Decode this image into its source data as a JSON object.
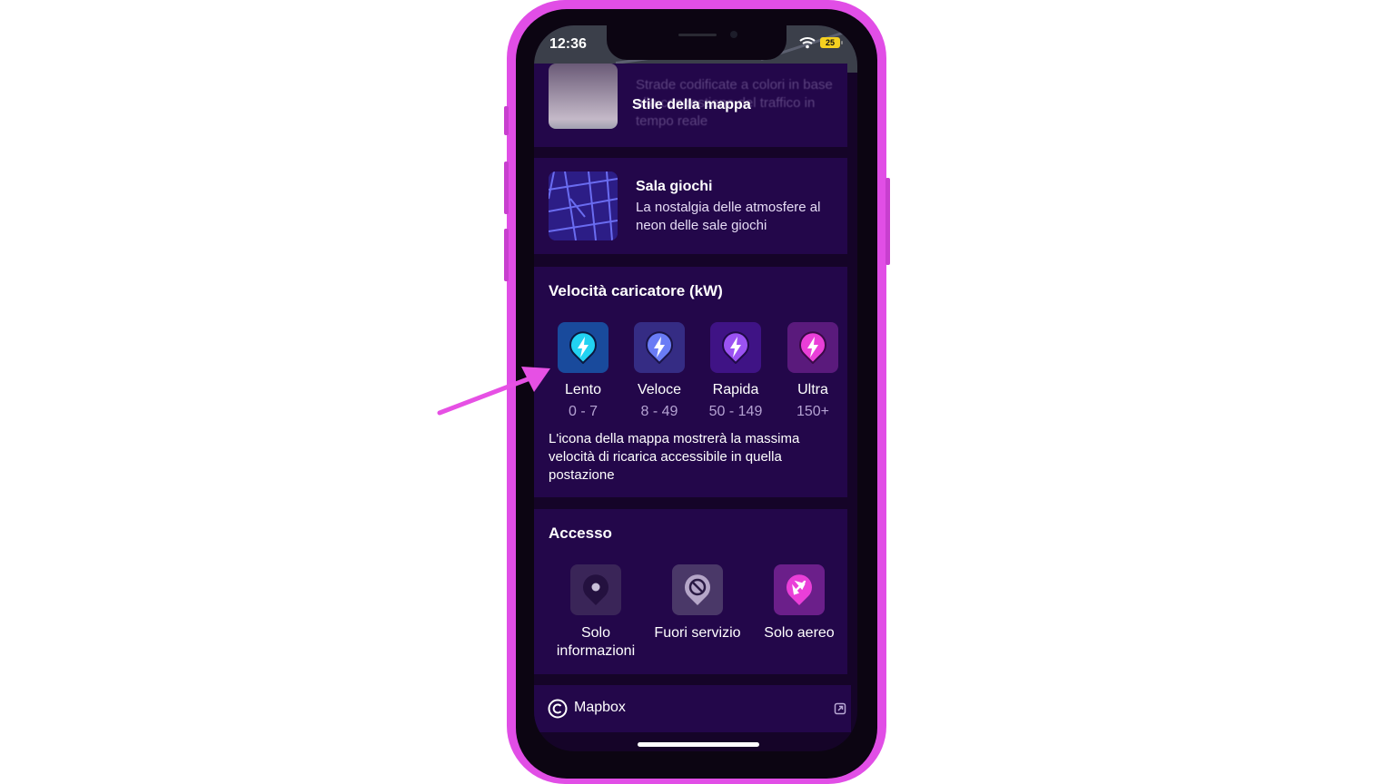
{
  "status_bar": {
    "time": "12:36",
    "battery": "25"
  },
  "map_style_card": {
    "selected_name": "Stile della mappa",
    "faded_description": "Strade codificate a colori in base alla congestione del traffico in tempo reale"
  },
  "arcade_style": {
    "name": "Sala giochi",
    "description": "La nostalgia delle atmosfere al neon delle sale giochi"
  },
  "charger_speed": {
    "title": "Velocità caricatore (kW)",
    "items": [
      {
        "label": "Lento",
        "range": "0 - 7",
        "color": "#22d3f2",
        "tile": "#194a9c",
        "icon": "bolt-pin-icon"
      },
      {
        "label": "Veloce",
        "range": "8 - 49",
        "color": "#6a7cf5",
        "tile": "#352c84",
        "icon": "bolt-pin-icon"
      },
      {
        "label": "Rapida",
        "range": "50 - 149",
        "color": "#9b52f2",
        "tile": "#3f1385",
        "icon": "bolt-pin-icon"
      },
      {
        "label": "Ultra",
        "range": "150+",
        "color": "#ea3fd8",
        "tile": "#5a1a7c",
        "icon": "bolt-pin-icon"
      }
    ],
    "note": "L'icona della mappa mostrerà la massima velocità di ricarica accessibile in quella postazione"
  },
  "access": {
    "title": "Accesso",
    "items": [
      {
        "label": "Solo informazioni",
        "icon": "info-dot-pin-icon"
      },
      {
        "label": "Fuori servizio",
        "icon": "prohibited-icon"
      },
      {
        "label": "Solo aereo",
        "icon": "airplane-icon"
      }
    ]
  },
  "footer": {
    "attribution": "Mapbox"
  },
  "colors": {
    "background": "#150428",
    "card": "#23074a",
    "phone_frame": "#e14ee6",
    "accent_arrow": "#e650e4"
  }
}
